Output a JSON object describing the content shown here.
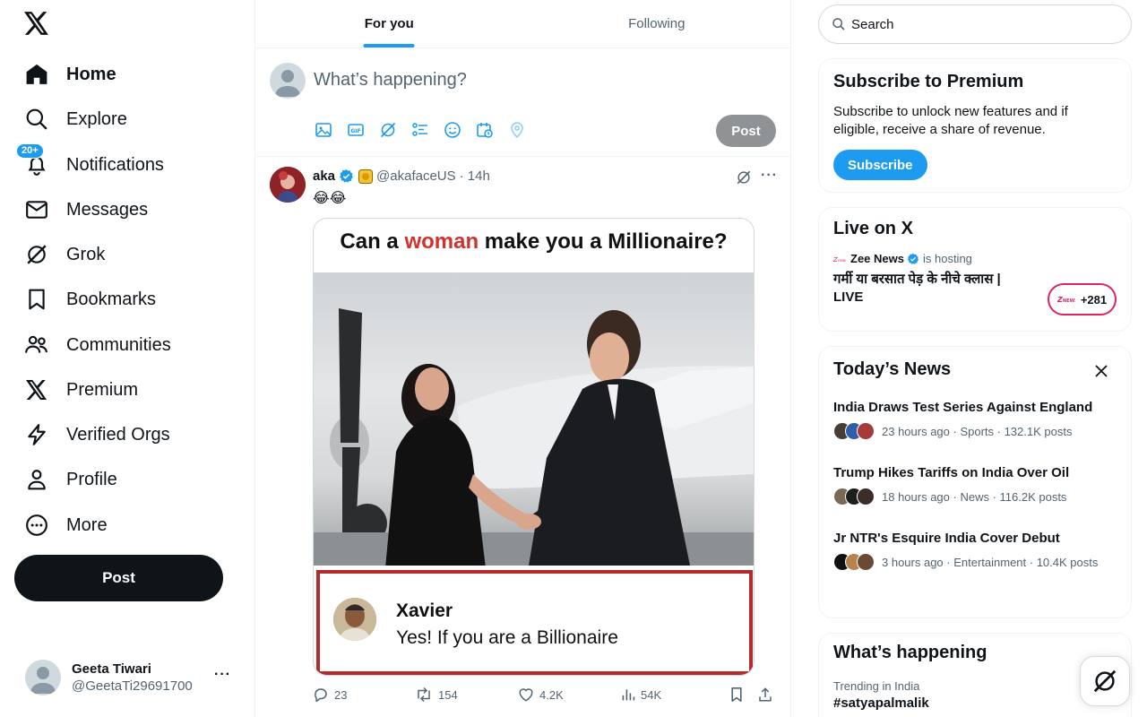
{
  "nav": {
    "items": [
      {
        "label": "Home",
        "icon": "home-icon",
        "active": true
      },
      {
        "label": "Explore",
        "icon": "search-icon"
      },
      {
        "label": "Notifications",
        "icon": "bell-icon",
        "badge": "20+"
      },
      {
        "label": "Messages",
        "icon": "mail-icon"
      },
      {
        "label": "Grok",
        "icon": "grok-icon"
      },
      {
        "label": "Bookmarks",
        "icon": "bookmark-icon"
      },
      {
        "label": "Communities",
        "icon": "people-icon"
      },
      {
        "label": "Premium",
        "icon": "x-logo-icon"
      },
      {
        "label": "Verified Orgs",
        "icon": "lightning-icon"
      },
      {
        "label": "Profile",
        "icon": "person-icon"
      },
      {
        "label": "More",
        "icon": "more-circle-icon"
      }
    ],
    "post_label": "Post"
  },
  "account": {
    "name": "Geeta Tiwari",
    "handle": "@GeetaTi29691700",
    "more": "···"
  },
  "timeline": {
    "tabs": [
      {
        "label": "For you",
        "active": true
      },
      {
        "label": "Following"
      }
    ],
    "compose": {
      "placeholder": "What’s happening?",
      "post_label": "Post"
    },
    "tweet": {
      "name": "aka",
      "handle": "@akafaceUS",
      "time": "· 14h",
      "text": "😂😂",
      "media": {
        "title_pre": "Can a ",
        "title_red": "woman",
        "title_post": " make you a Millionaire?",
        "reply_name": "Xavier",
        "reply_text": "Yes! If you are a Billionaire"
      },
      "stats": {
        "replies": "23",
        "reposts": "154",
        "likes": "4.2K",
        "views": "54K"
      }
    }
  },
  "sidebar": {
    "search_placeholder": "Search",
    "premium": {
      "title": "Subscribe to Premium",
      "text": "Subscribe to unlock new features and if eligible, receive a share of revenue.",
      "button": "Subscribe"
    },
    "live": {
      "title": "Live on X",
      "host": "Zee News",
      "hosting": "is hosting",
      "headline": "गर्मी या बरसात पेड़ के नीचे क्लास | LIVE",
      "count": "+281"
    },
    "news": {
      "title": "Today’s News",
      "items": [
        {
          "headline": "India Draws Test Series Against England",
          "meta": "23 hours ago · Sports · 132.1K posts"
        },
        {
          "headline": "Trump Hikes Tariffs on India Over Oil",
          "meta": "18 hours ago · News · 116.2K posts"
        },
        {
          "headline": "Jr NTR's Esquire India Cover Debut",
          "meta": "3 hours ago · Entertainment · 10.4K posts"
        }
      ]
    },
    "happening": {
      "title": "What’s happening",
      "trend_context": "Trending in India",
      "trend": "#satyapalmalik"
    }
  },
  "colors": {
    "accent": "#1d9bf0",
    "text": "#0f1419",
    "muted": "#536471",
    "red": "#d2322d"
  }
}
